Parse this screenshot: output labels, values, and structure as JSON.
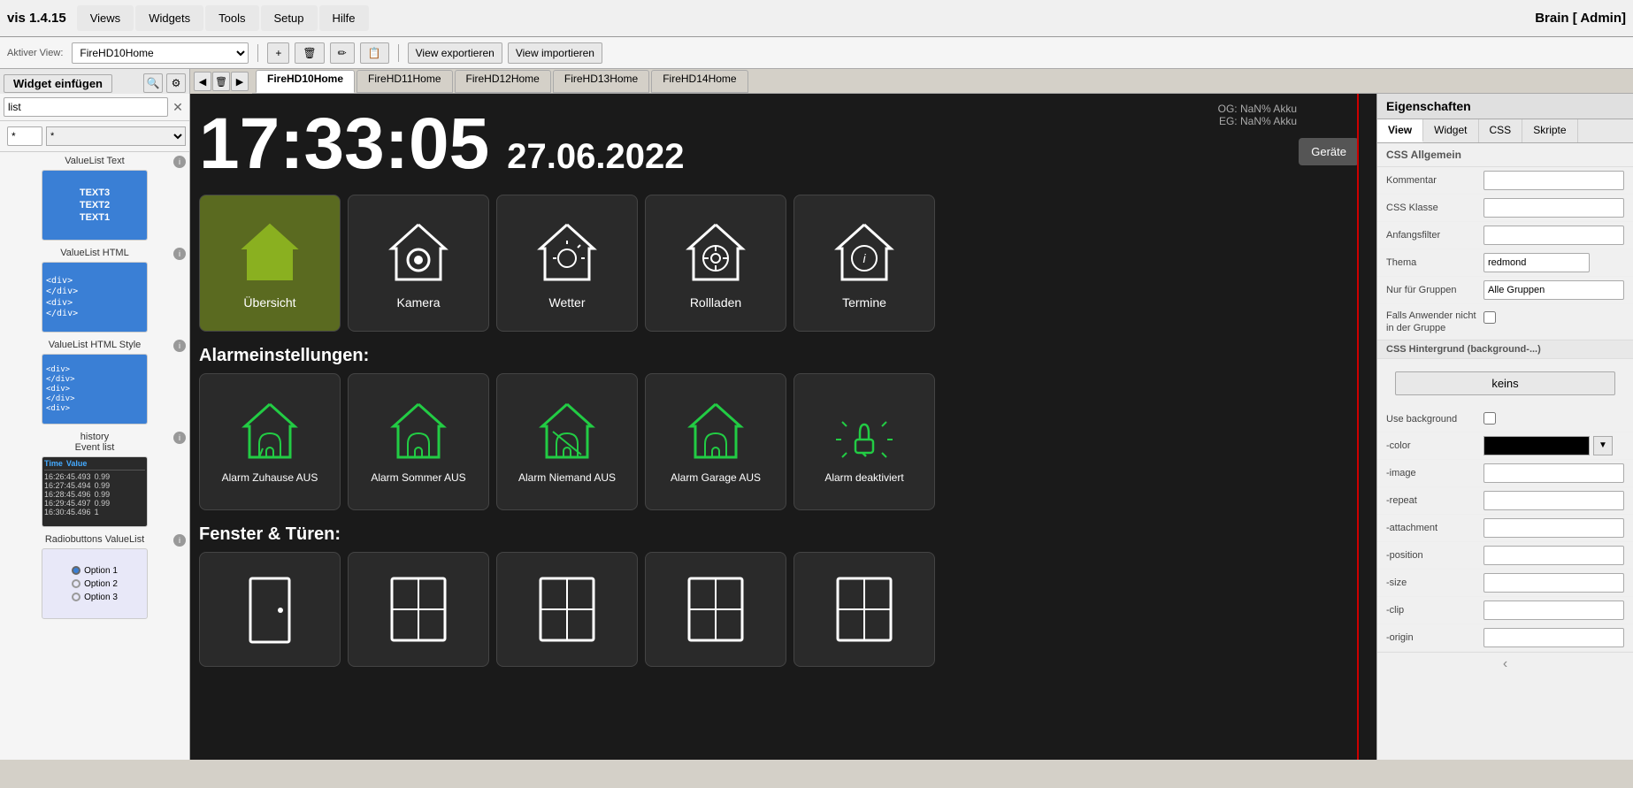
{
  "app": {
    "title": "vis 1.4.15",
    "brain_label": "Brain [ Admin]"
  },
  "menu": {
    "items": [
      "Views",
      "Widgets",
      "Tools",
      "Setup",
      "Hilfe"
    ]
  },
  "toolbar": {
    "aktiver_view_label": "Aktiver View:",
    "view_select_value": "FireHD10Home",
    "view_select_options": [
      "FireHD10Home",
      "FireHD11Home",
      "FireHD12Home",
      "FireHD13Home",
      "FireHD14Home"
    ],
    "export_btn": "View exportieren",
    "import_btn": "View importieren"
  },
  "widget_panel": {
    "add_btn": "Widget einfügen",
    "search_value": "list",
    "star_value": "*",
    "widgets": [
      {
        "name": "ValueList Text",
        "preview_type": "vlt",
        "lines": [
          "TEXT3",
          "TEXT2",
          "TEXT1"
        ]
      },
      {
        "name": "ValueList HTML",
        "preview_type": "vlh",
        "lines": [
          "<div>",
          "</div>",
          "",
          "<div>",
          "</div>"
        ]
      },
      {
        "name": "ValueList HTML Style",
        "preview_type": "vlhs",
        "lines": [
          "<div>",
          "</div>",
          "<div>",
          "</div>",
          "<div>"
        ]
      },
      {
        "name": "history Event list",
        "preview_type": "hist",
        "header": [
          "Time",
          "Value"
        ],
        "rows": [
          [
            "16:26:45.493",
            "0.99"
          ],
          [
            "16:27:45.494",
            "0.99"
          ],
          [
            "16:28:45.496",
            "0.99"
          ],
          [
            "16:29:45.497",
            "0.99"
          ],
          [
            "16:30:45.496",
            "1"
          ]
        ]
      },
      {
        "name": "Radiobuttons ValueList",
        "preview_type": "radio"
      }
    ]
  },
  "tabs": {
    "nav_tabs": [
      "FireHD10Home",
      "FireHD11Home",
      "FireHD12Home",
      "FireHD13Home",
      "FireHD14Home"
    ],
    "active_tab": "FireHD10Home"
  },
  "canvas": {
    "time": "17:33:05",
    "date": "27.06.2022",
    "og_info": "OG: NaN% Akku",
    "eg_info": "EG: NaN% Akku",
    "geraete_btn": "Geräte",
    "nav_tiles": [
      {
        "label": "Übersicht",
        "active": true
      },
      {
        "label": "Kamera",
        "active": false
      },
      {
        "label": "Wetter",
        "active": false
      },
      {
        "label": "Rollladen",
        "active": false
      },
      {
        "label": "Termine",
        "active": false
      }
    ],
    "alarm_section": "Alarmeinstellungen:",
    "alarm_tiles": [
      {
        "label": "Alarm Zuhause AUS"
      },
      {
        "label": "Alarm Sommer AUS"
      },
      {
        "label": "Alarm Niemand AUS"
      },
      {
        "label": "Alarm Garage AUS"
      },
      {
        "label": "Alarm deaktiviert"
      }
    ],
    "fenster_section": "Fenster & Türen:",
    "window_tiles": [
      {
        "label": ""
      },
      {
        "label": ""
      },
      {
        "label": ""
      },
      {
        "label": ""
      },
      {
        "label": ""
      }
    ]
  },
  "properties": {
    "header": "Eigenschaften",
    "tabs": [
      "View",
      "Widget",
      "CSS",
      "Skripte"
    ],
    "active_tab": "View",
    "css_allgemein": "CSS Allgemein",
    "fields": [
      {
        "label": "Kommentar",
        "type": "input",
        "value": ""
      },
      {
        "label": "CSS Klasse",
        "type": "input",
        "value": ""
      },
      {
        "label": "Anfangsfilter",
        "type": "input",
        "value": ""
      },
      {
        "label": "Thema",
        "type": "input",
        "value": "redmond"
      },
      {
        "label": "Nur für Gruppen",
        "type": "input",
        "value": "Alle Gruppen"
      },
      {
        "label": "Falls Anwender nicht in der Gruppe",
        "type": "checkbox",
        "value": false
      },
      {
        "label": "CSS Hintergrund (background-...)",
        "type": "section"
      },
      {
        "label": "",
        "type": "keins_btn",
        "value": "keins"
      },
      {
        "label": "Use background",
        "type": "checkbox",
        "value": false
      },
      {
        "label": "-color",
        "type": "color",
        "value": "black"
      },
      {
        "label": "-image",
        "type": "input",
        "value": ""
      },
      {
        "label": "-repeat",
        "type": "input",
        "value": ""
      },
      {
        "label": "-attachment",
        "type": "input",
        "value": ""
      },
      {
        "label": "-position",
        "type": "input",
        "value": ""
      },
      {
        "label": "-size",
        "type": "input",
        "value": ""
      },
      {
        "label": "-clip",
        "type": "input",
        "value": ""
      },
      {
        "label": "-origin",
        "type": "input",
        "value": ""
      }
    ]
  }
}
